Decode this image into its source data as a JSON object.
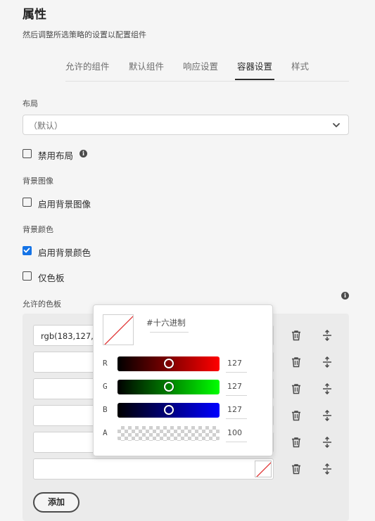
{
  "header": {
    "title": "属性",
    "subtitle": "然后调整所选策略的设置以配置组件"
  },
  "tabs": [
    {
      "label": "允许的组件",
      "active": false
    },
    {
      "label": "默认组件",
      "active": false
    },
    {
      "label": "响应设置",
      "active": false
    },
    {
      "label": "容器设置",
      "active": true
    },
    {
      "label": "样式",
      "active": false
    }
  ],
  "layout": {
    "label": "布局",
    "select_value": "（默认）",
    "disable_layout_label": "禁用布局",
    "disable_layout_checked": false
  },
  "background_image": {
    "label": "背景图像",
    "enable_label": "启用背景图像",
    "checked": false
  },
  "background_color": {
    "label": "背景颜色",
    "enable_label": "启用背景颜色",
    "enable_checked": true,
    "swatches_only_label": "仅色板",
    "swatches_only_checked": false
  },
  "palette": {
    "label": "允许的色板",
    "rows": [
      {
        "value": "rgb(183,127,127"
      },
      {
        "value": ""
      },
      {
        "value": ""
      },
      {
        "value": ""
      },
      {
        "value": ""
      },
      {
        "value": ""
      }
    ],
    "add_label": "添加"
  },
  "color_picker": {
    "hex_label": "#十六进制",
    "channels": [
      {
        "name": "R",
        "value": "127",
        "level": 0.5
      },
      {
        "name": "G",
        "value": "127",
        "level": 0.5
      },
      {
        "name": "B",
        "value": "127",
        "level": 0.5
      },
      {
        "name": "A",
        "value": "100",
        "level": 1.0
      }
    ]
  },
  "colors": {
    "accent": "#1473e6",
    "text": "#2c2c2c",
    "background": "#f5f5f5"
  },
  "icons": {
    "info": "info-icon",
    "chevron": "chevron-down-icon",
    "trash": "trash-icon",
    "move": "move-vertical-icon"
  }
}
